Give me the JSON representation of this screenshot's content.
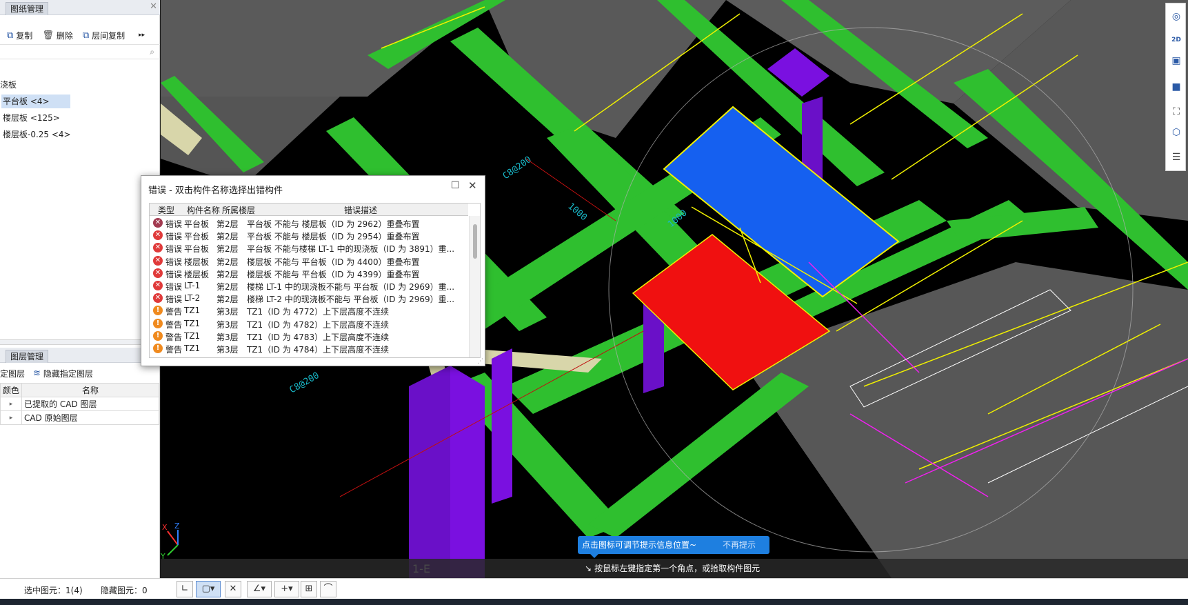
{
  "drawing_panel": {
    "tab_label": "图纸管理",
    "close_glyph": "✕",
    "toolbar": [
      {
        "icon": "copy-icon",
        "glyph": "⧉",
        "label": "复制"
      },
      {
        "icon": "delete-icon",
        "glyph": "🗑",
        "label": "删除"
      },
      {
        "icon": "floor-copy-icon",
        "glyph": "⧉",
        "label": "层间复制"
      }
    ],
    "more_glyph": "▸▸"
  },
  "component_tree": [
    {
      "label": "浇板",
      "selected": false
    },
    {
      "label": "平台板 <4>",
      "selected": true
    },
    {
      "label": "楼层板 <125>",
      "selected": false
    },
    {
      "label": "楼层板-0.25 <4>",
      "selected": false
    }
  ],
  "layer_panel": {
    "tab_label": "图层管理",
    "toolbar": [
      {
        "label": "定图层"
      },
      {
        "icon": "hide-layer-icon",
        "label": "隐藏指定图层"
      }
    ],
    "columns": [
      "颜色",
      "名称"
    ],
    "rows": [
      {
        "expander": "▸",
        "name": "已提取的 CAD 图层"
      },
      {
        "expander": "▸",
        "name": "CAD 原始图层"
      }
    ]
  },
  "error_dialog": {
    "title": "错误 - 双击构件名称选择出错构件",
    "maximize_glyph": "☐",
    "close_glyph": "✕",
    "columns": [
      "类型",
      "构件名称",
      "所属楼层",
      "错误描述"
    ],
    "rows": [
      {
        "severity": "error-dark",
        "type": "错误",
        "name": "平台板",
        "floor": "第2层",
        "desc": "平台板 不能与 楼层板（ID 为 2962）重叠布置"
      },
      {
        "severity": "error",
        "type": "错误",
        "name": "平台板",
        "floor": "第2层",
        "desc": "平台板 不能与 楼层板（ID 为 2954）重叠布置"
      },
      {
        "severity": "error",
        "type": "错误",
        "name": "平台板",
        "floor": "第2层",
        "desc": "平台板 不能与楼梯 LT-1 中的现浇板（ID 为 3891）重..."
      },
      {
        "severity": "error",
        "type": "错误",
        "name": "楼层板",
        "floor": "第2层",
        "desc": "楼层板 不能与 平台板（ID 为 4400）重叠布置"
      },
      {
        "severity": "error",
        "type": "错误",
        "name": "楼层板",
        "floor": "第2层",
        "desc": "楼层板 不能与 平台板（ID 为 4399）重叠布置"
      },
      {
        "severity": "error",
        "type": "错误",
        "name": "LT-1",
        "floor": "第2层",
        "desc": "楼梯 LT-1 中的现浇板不能与 平台板（ID 为 2969）重..."
      },
      {
        "severity": "error",
        "type": "错误",
        "name": "LT-2",
        "floor": "第2层",
        "desc": "楼梯 LT-2 中的现浇板不能与 平台板（ID 为 2969）重..."
      },
      {
        "severity": "warn",
        "type": "警告",
        "name": "TZ1",
        "floor": "第3层",
        "desc": "TZ1（ID 为 4772）上下层高度不连续"
      },
      {
        "severity": "warn",
        "type": "警告",
        "name": "TZ1",
        "floor": "第3层",
        "desc": "TZ1（ID 为 4782）上下层高度不连续"
      },
      {
        "severity": "warn",
        "type": "警告",
        "name": "TZ1",
        "floor": "第3层",
        "desc": "TZ1（ID 为 4783）上下层高度不连续"
      },
      {
        "severity": "warn",
        "type": "警告",
        "name": "TZ1",
        "floor": "第3层",
        "desc": "TZ1（ID 为 4784）上下层高度不连续"
      }
    ]
  },
  "viewport": {
    "hint_bubble": {
      "text": "点击图标可调节提示信息位置~",
      "dismiss": "不再提示"
    },
    "command_hint": "按鼠标左键指定第一个角点，或拾取构件图元",
    "grid_label": "1-E",
    "axis_labels": {
      "x": "X",
      "y": "Y",
      "z": "Z"
    },
    "colors": {
      "beam": "#2fbf2f",
      "slab": "#5a5a5a",
      "selected_slab_blue": "#1560f0",
      "selected_slab_red": "#f01010",
      "column": "#7a10e0",
      "stair": "#d8d6aa",
      "rebar_line": "#f0f000",
      "magenta_line": "#f020f0"
    }
  },
  "right_toolbar": [
    {
      "icon": "orbit-icon",
      "glyph": "◎"
    },
    {
      "icon": "view-2d-icon",
      "glyph": "2D"
    },
    {
      "icon": "view-3d-box-icon",
      "glyph": "▣"
    },
    {
      "icon": "view-3d-solid-icon",
      "glyph": "■"
    },
    {
      "icon": "fullscreen-icon",
      "glyph": "⛶"
    },
    {
      "icon": "component-display-icon",
      "glyph": "⬡"
    },
    {
      "icon": "properties-icon",
      "glyph": "☰"
    }
  ],
  "status_bar": {
    "selected": "选中图元：1(4)",
    "hidden": "隐藏图元：0"
  },
  "snap_toolbar": [
    {
      "icon": "ortho-icon",
      "glyph": "∟"
    },
    {
      "icon": "box-select-icon",
      "glyph": "▢▾"
    },
    {
      "icon": "cross-select-icon",
      "glyph": "✕"
    },
    {
      "icon": "angle-icon",
      "glyph": "∠▾"
    },
    {
      "icon": "snap-point-icon",
      "glyph": "+▾"
    },
    {
      "icon": "dynamic-input-icon",
      "glyph": "⊞"
    },
    {
      "icon": "arc-icon",
      "glyph": "⌒"
    }
  ]
}
